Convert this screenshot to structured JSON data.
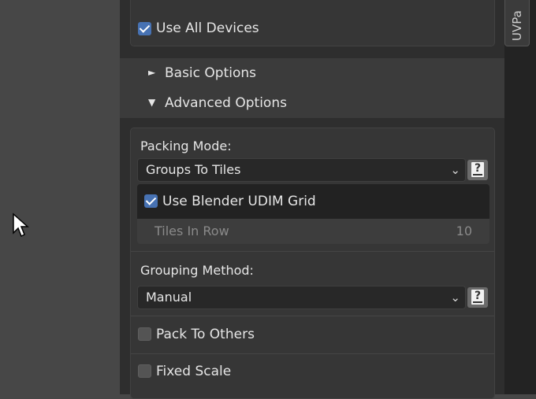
{
  "tab": {
    "label": "UVPa"
  },
  "top": {
    "use_all_devices": "Use All Devices",
    "use_all_devices_checked": true
  },
  "sections": [
    {
      "label": "Basic Options",
      "expanded": false
    },
    {
      "label": "Advanced Options",
      "expanded": true
    }
  ],
  "advanced": {
    "packing_mode_label": "Packing Mode:",
    "packing_mode_value": "Groups To Tiles",
    "use_udim_label": "Use Blender UDIM Grid",
    "use_udim_checked": true,
    "tiles_in_row_label": "Tiles In Row",
    "tiles_in_row_value": "10",
    "grouping_method_label": "Grouping Method:",
    "grouping_method_value": "Manual",
    "pack_to_others_label": "Pack To Others",
    "pack_to_others_checked": false,
    "fixed_scale_label": "Fixed Scale",
    "fixed_scale_checked": false
  },
  "icons": {
    "expand_closed": "►",
    "expand_open": "▼",
    "chevron": "⌄",
    "help": "?"
  },
  "colors": {
    "accent": "#4772b3",
    "panel": "#2e2e2e",
    "field": "#282828"
  }
}
